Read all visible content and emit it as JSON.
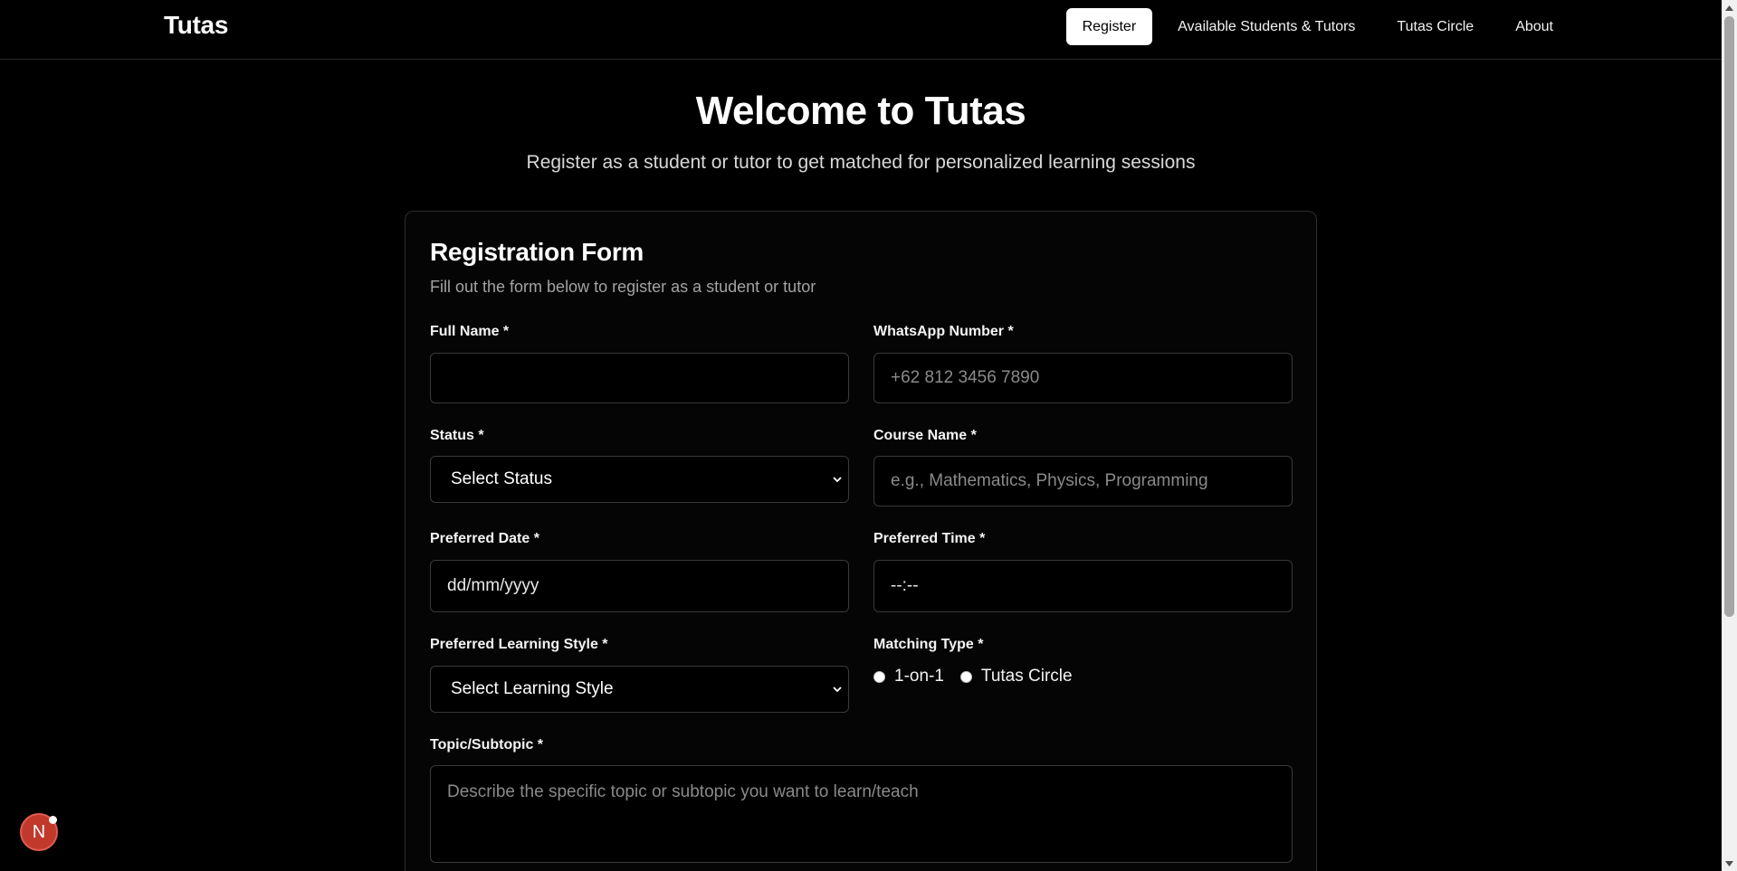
{
  "app": {
    "brand": "Tutas"
  },
  "nav": {
    "items": [
      {
        "label": "Register",
        "active": true
      },
      {
        "label": "Available Students & Tutors",
        "active": false
      },
      {
        "label": "Tutas Circle",
        "active": false
      },
      {
        "label": "About",
        "active": false
      }
    ]
  },
  "hero": {
    "title": "Welcome to Tutas",
    "subtitle": "Register as a student or tutor to get matched for personalized learning sessions"
  },
  "form": {
    "title": "Registration Form",
    "description": "Fill out the form below to register as a student or tutor",
    "full_name": {
      "label": "Full Name *",
      "value": "",
      "placeholder": ""
    },
    "whatsapp": {
      "label": "WhatsApp Number *",
      "value": "",
      "placeholder": "+62 812 3456 7890"
    },
    "status": {
      "label": "Status *",
      "selected": "Select Status"
    },
    "course": {
      "label": "Course Name *",
      "value": "",
      "placeholder": "e.g., Mathematics, Physics, Programming"
    },
    "date": {
      "label": "Preferred Date *",
      "display": "dd/mm/yyyy"
    },
    "time": {
      "label": "Preferred Time *",
      "display": "--:--"
    },
    "learning_style": {
      "label": "Preferred Learning Style *",
      "selected": "Select Learning Style"
    },
    "matching_type": {
      "label": "Matching Type *",
      "options": [
        "1-on-1",
        "Tutas Circle"
      ]
    },
    "topic": {
      "label": "Topic/Subtopic *",
      "placeholder": "Describe the specific topic or subtopic you want to learn/teach"
    }
  },
  "badge": {
    "letter": "N",
    "color": "#c0392b"
  }
}
